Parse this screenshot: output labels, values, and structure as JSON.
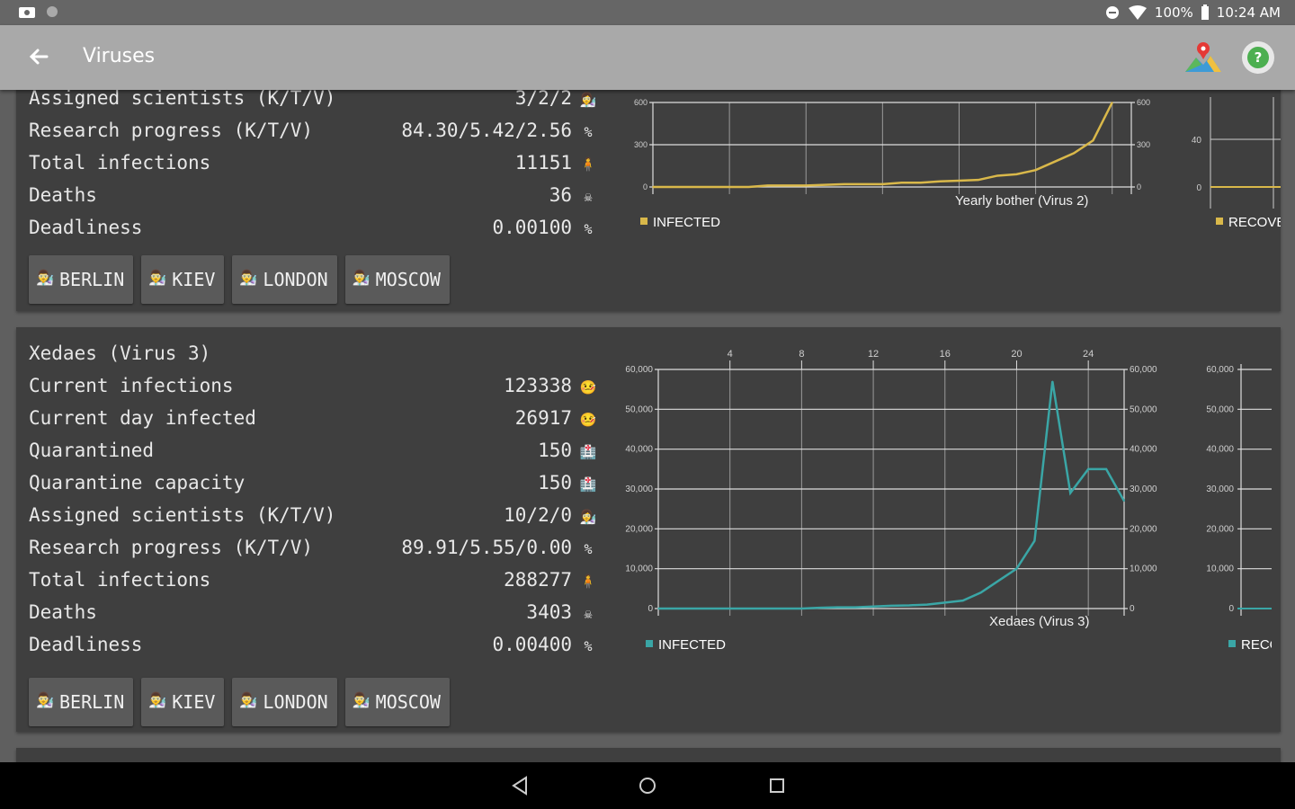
{
  "status_bar": {
    "battery": "100%",
    "time": "10:24 AM"
  },
  "app_bar": {
    "title": "Viruses",
    "back_icon": "arrow-left-icon",
    "map_icon": "map-pin-icon",
    "help_icon": "help-icon"
  },
  "colors": {
    "virus2_line": "#d9b84a",
    "virus3_line": "#3aa6a6",
    "card_bg": "#3f3f3f"
  },
  "virus2": {
    "cut_row": {
      "label": "Assigned scientists (K/T/V)",
      "value": "3/2/2"
    },
    "stats": [
      {
        "label": "Research progress (K/T/V)",
        "value": "84.30/5.42/2.56",
        "icon": "percent"
      },
      {
        "label": "Total infections",
        "value": "11151",
        "icon": "person-icon"
      },
      {
        "label": "Deaths",
        "value": "36",
        "icon": "skull-icon"
      },
      {
        "label": "Deadliness",
        "value": "0.00100",
        "icon": "percent"
      }
    ],
    "cities": [
      "BERLIN",
      "KIEV",
      "LONDON",
      "MOSCOW"
    ],
    "chart_legend": "INFECTED",
    "recovered_legend": "RECOVE",
    "chart_caption": "Yearly bother (Virus 2)"
  },
  "virus3": {
    "name": "Xedaes (Virus 3)",
    "stats": [
      {
        "label": "Current infections",
        "value": "123338",
        "icon": "sick-person-icon"
      },
      {
        "label": "Current day infected",
        "value": "26917",
        "icon": "sick-person-icon"
      },
      {
        "label": "Quarantined",
        "value": "150",
        "icon": "quarantine-icon"
      },
      {
        "label": "Quarantine capacity",
        "value": "150",
        "icon": "quarantine-icon"
      },
      {
        "label": "Assigned scientists (K/T/V)",
        "value": "10/2/0",
        "icon": "scientist-icon"
      },
      {
        "label": "Research progress (K/T/V)",
        "value": "89.91/5.55/0.00",
        "icon": "percent"
      },
      {
        "label": "Total infections",
        "value": "288277",
        "icon": "person-icon"
      },
      {
        "label": "Deaths",
        "value": "3403",
        "icon": "skull-icon"
      },
      {
        "label": "Deadliness",
        "value": "0.00400",
        "icon": "percent"
      }
    ],
    "cities": [
      "BERLIN",
      "KIEV",
      "LONDON",
      "MOSCOW"
    ],
    "chart_legend": "INFECTED",
    "recovered_legend": "RECO",
    "chart_caption": "Xedaes (Virus 3)"
  },
  "chart_data": [
    {
      "type": "line",
      "caption": "Yearly bother (Virus 2)",
      "series": [
        {
          "name": "INFECTED",
          "x": [
            0,
            1,
            2,
            3,
            4,
            5,
            6,
            7,
            8,
            9,
            10,
            11,
            12,
            13,
            14,
            15,
            16,
            17,
            18,
            19,
            20,
            21,
            22,
            23,
            24
          ],
          "values": [
            0,
            0,
            0,
            0,
            0,
            0,
            10,
            10,
            10,
            15,
            20,
            20,
            20,
            30,
            30,
            40,
            45,
            50,
            80,
            90,
            120,
            180,
            240,
            330,
            600
          ]
        }
      ],
      "y_ticks": [
        0,
        300,
        600
      ],
      "ylim": [
        0,
        600
      ],
      "legend_placement": "bottom-left"
    },
    {
      "type": "line",
      "caption": "Xedaes (Virus 3)",
      "x_ticks": [
        4,
        8,
        12,
        16,
        20,
        24
      ],
      "series": [
        {
          "name": "INFECTED",
          "x": [
            0,
            1,
            2,
            3,
            4,
            5,
            6,
            7,
            8,
            9,
            10,
            11,
            12,
            13,
            14,
            15,
            16,
            17,
            18,
            19,
            20,
            21,
            22,
            23,
            24,
            25,
            26
          ],
          "values": [
            0,
            0,
            0,
            0,
            0,
            0,
            0,
            0,
            0,
            200,
            300,
            300,
            500,
            700,
            800,
            1000,
            1500,
            2000,
            4000,
            7000,
            10000,
            17000,
            57000,
            29000,
            35000,
            35000,
            27000
          ]
        }
      ],
      "y_ticks": [
        0,
        10000,
        20000,
        30000,
        40000,
        50000,
        60000
      ],
      "y_tick_labels": [
        "0",
        "10,000",
        "20,000",
        "30,000",
        "40,000",
        "50,000",
        "60,000"
      ],
      "ylim": [
        0,
        60000
      ],
      "legend_placement": "bottom-left"
    }
  ]
}
